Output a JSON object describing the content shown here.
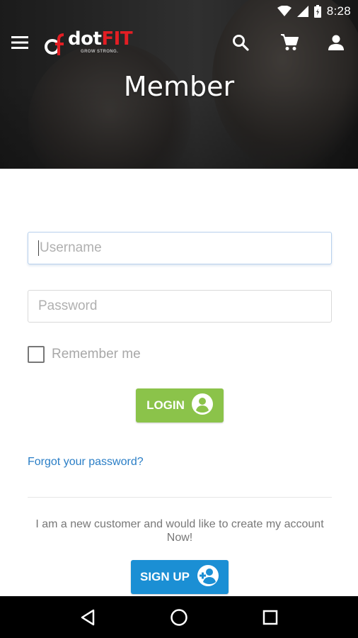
{
  "status_bar": {
    "time": "8:28"
  },
  "header": {
    "logo_text_dot": "dot",
    "logo_text_fit": "FIT",
    "logo_tagline": "GROW STRONG.",
    "title": "Member"
  },
  "form": {
    "username_placeholder": "Username",
    "password_placeholder": "Password",
    "remember_label": "Remember me",
    "login_label": "LOGIN",
    "forgot_label": "Forgot your password?"
  },
  "signup": {
    "prompt": "I am a new customer and would like to create my account Now!",
    "button_label": "SIGN UP"
  },
  "colors": {
    "login_green": "#8bc34a",
    "signup_blue": "#1b8fd4",
    "link_blue": "#2a7ec6",
    "brand_red": "#e31e24"
  },
  "icons": [
    "menu-icon",
    "search-icon",
    "cart-icon",
    "account-icon",
    "back-icon",
    "home-icon",
    "recents-icon"
  ]
}
